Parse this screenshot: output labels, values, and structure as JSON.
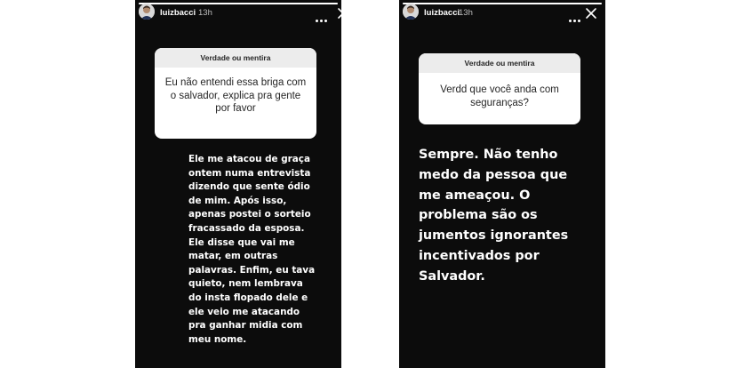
{
  "stories": [
    {
      "username": "luizbacci",
      "time": "13h",
      "question_header": "Verdade ou mentira",
      "question": "Eu não entendi essa briga com o salvador, explica pra gente por favor",
      "answer_lines": [
        "Ele me atacou de graça",
        "ontem numa entrevista",
        "dizendo que sente ódio",
        "de mim. Após isso,",
        "apenas postei o sorteio",
        "fracassado da esposa.",
        "Ele disse que vai me",
        "matar, em outras",
        "palavras. Enfim, eu tava",
        "quieto, nem lembrava",
        "do insta flopado dele e",
        "ele veio me atacando",
        "pra ganhar midia com",
        "meu nome."
      ],
      "progress": 1.0,
      "icons": {
        "avatar": "avatar-photo",
        "menu": "more-dots-icon",
        "close": "close-icon"
      }
    },
    {
      "username": "luizbacci",
      "time": "13h",
      "question_header": "Verdade ou mentira",
      "question": "Verdd que você anda com seguranças?",
      "answer_lines": [
        "Sempre. Não tenho",
        "medo da pessoa que",
        "me ameaçou. O",
        "problema são os",
        "jumentos ignorantes",
        "incentivados por",
        "Salvador."
      ],
      "progress": 1.0,
      "icons": {
        "avatar": "avatar-photo",
        "menu": "more-dots-icon",
        "close": "close-icon"
      }
    }
  ],
  "colors": {
    "story_bg": "#0c0c0c",
    "card_bg": "#ffffff",
    "card_header_bg": "#ececec",
    "text_dark": "#262626"
  }
}
